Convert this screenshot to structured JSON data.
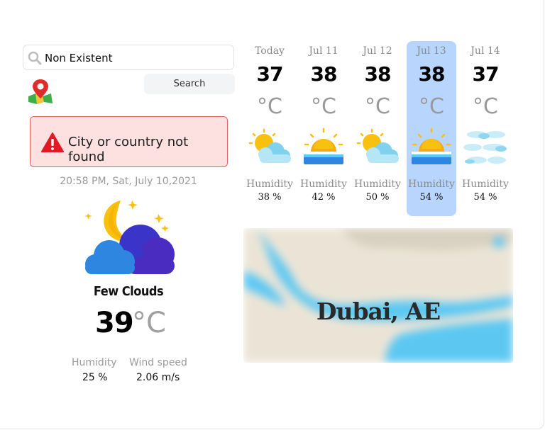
{
  "search": {
    "value": "Non Existent",
    "button_label": "Search"
  },
  "error": {
    "message": "City or country not found"
  },
  "current": {
    "datetime": "20:58 PM, Sat, July 10,2021",
    "condition": "Few Clouds",
    "temperature": "39",
    "unit": "°C",
    "humidity_label": "Humidity",
    "humidity_value": "25 %",
    "wind_label": "Wind speed",
    "wind_value": "2.06 m/s"
  },
  "forecast": [
    {
      "date": "Today",
      "temp": "37",
      "unit": "°C",
      "icon": "sun-cloud-icon",
      "humidity_label": "Humidity",
      "humidity": "38 %"
    },
    {
      "date": "Jul 11",
      "temp": "38",
      "unit": "°C",
      "icon": "sunset-sea-icon",
      "humidity_label": "Humidity",
      "humidity": "42 %"
    },
    {
      "date": "Jul 12",
      "temp": "38",
      "unit": "°C",
      "icon": "sun-cloud-icon",
      "humidity_label": "Humidity",
      "humidity": "50 %"
    },
    {
      "date": "Jul 13",
      "temp": "38",
      "unit": "°C",
      "icon": "sunset-sea-icon",
      "humidity_label": "Humidity",
      "humidity": "54 %"
    },
    {
      "date": "Jul 14",
      "temp": "37",
      "unit": "°C",
      "icon": "clouds-icon",
      "humidity_label": "Humidity",
      "humidity": "54 %"
    }
  ],
  "selected_day_index": 3,
  "map": {
    "city": "Dubai, AE"
  },
  "colors": {
    "selected_day": "#b7d5fd",
    "error_bg": "#fde0e0",
    "error_border": "#e06464",
    "sea": "#5cc8f2"
  }
}
